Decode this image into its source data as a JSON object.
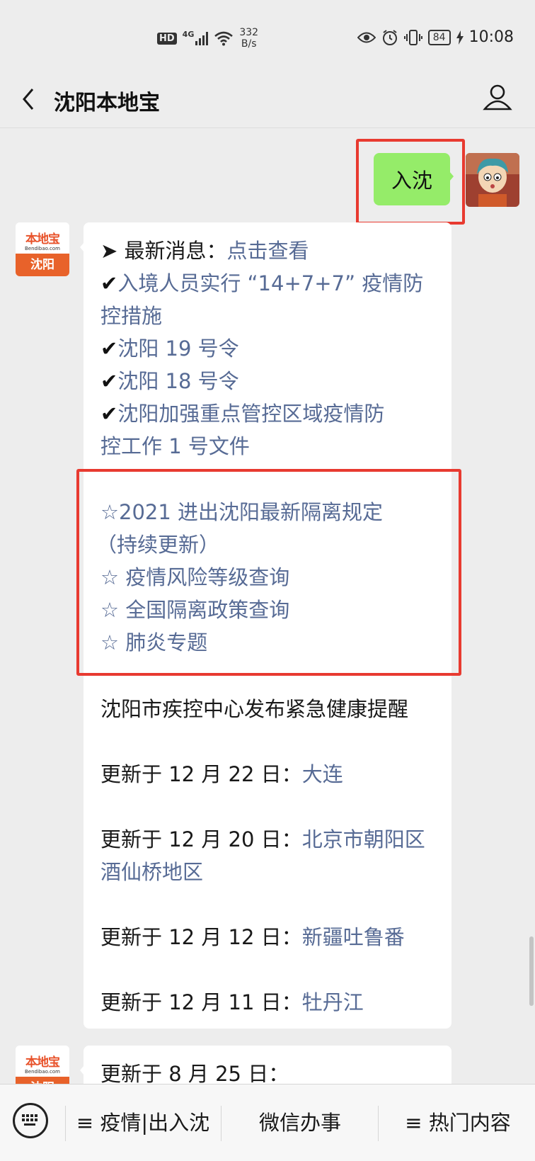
{
  "status_bar": {
    "hd": "HD",
    "signal_type": "4G",
    "net_speed_value": "332",
    "net_speed_unit": "B/s",
    "battery": "84",
    "time": "10:08"
  },
  "nav": {
    "title": "沈阳本地宝"
  },
  "user_message": {
    "text": "入沈"
  },
  "bot_avatar": {
    "brand": "本地宝",
    "domain": "Bendibao.com",
    "city": "沈阳"
  },
  "message1": {
    "latest_prefix": "➤ 最新消息：",
    "latest_link": "点击查看",
    "items": [
      "入境人员实行 “14+7+7” 疫情防",
      "控措施",
      "沈阳 19 号令",
      "沈阳 18 号令",
      "沈阳加强重点管控区域疫情防",
      "控工作 1 号文件"
    ],
    "check_mark": "✔",
    "highlighted": [
      "☆2021 进出沈阳最新隔离规定",
      "（持续更新）",
      "☆ 疫情风险等级查询",
      "☆ 全国隔离政策查询",
      "☆ 肺炎专题"
    ],
    "cdc_reminder": "沈阳市疾控中心发布紧急健康提醒",
    "updates": [
      {
        "date": "更新于 12 月 22 日：",
        "place": "大连"
      },
      {
        "date": "更新于 12 月 20 日：",
        "place": "北京市朝阳区"
      },
      {
        "date": "",
        "place": "酒仙桥地区"
      },
      {
        "date": "更新于 12 月 12 日：",
        "place": "新疆吐鲁番"
      },
      {
        "date": "更新于 12 月 11 日：",
        "place": "牡丹江"
      }
    ]
  },
  "message2": {
    "text": "更新于 8 月 25 日："
  },
  "bottom_menu": {
    "items": [
      "≡ 疫情|出入沈",
      "微信办事",
      "≡ 热门内容"
    ]
  },
  "colors": {
    "link": "#576b95",
    "bubble_green": "#95ec69",
    "highlight": "#e83a30",
    "brand_orange": "#e8622a"
  }
}
